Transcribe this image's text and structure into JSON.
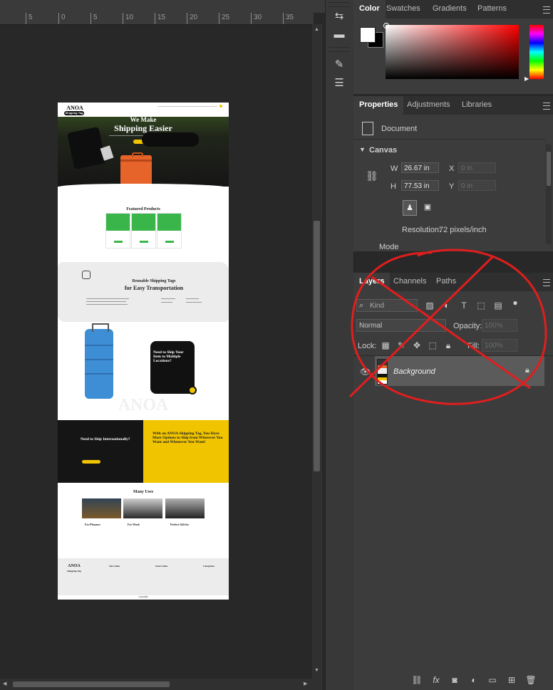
{
  "ruler": {
    "ticks": [
      "5",
      "0",
      "5",
      "10",
      "15",
      "20",
      "25",
      "30",
      "35"
    ]
  },
  "color_panel": {
    "tabs": [
      "Color",
      "Swatches",
      "Gradients",
      "Patterns"
    ],
    "active_tab": "Color",
    "foreground": "#ffffff",
    "background": "#000000",
    "hue": "#ff0000"
  },
  "properties_panel": {
    "tabs": [
      "Properties",
      "Adjustments",
      "Libraries"
    ],
    "active_tab": "Properties",
    "document_label": "Document",
    "section_title": "Canvas",
    "width_label": "W",
    "width_value": "26.67 in",
    "height_label": "H",
    "height_value": "77.53 in",
    "x_label": "X",
    "x_placeholder": "0 in",
    "y_label": "Y",
    "y_placeholder": "0 in",
    "resolution_label": "Resolution:",
    "resolution_value": "72 pixels/inch",
    "mode_label": "Mode"
  },
  "layers_panel": {
    "tabs": [
      "Layers",
      "Channels",
      "Paths"
    ],
    "active_tab": "Layers",
    "filter_placeholder": "Kind",
    "blend_mode": "Normal",
    "opacity_label": "Opacity:",
    "opacity_value": "100%",
    "lock_label": "Lock:",
    "fill_label": "Fill:",
    "fill_value": "100%",
    "layers": [
      {
        "name": "Background",
        "visible": true,
        "locked": true
      }
    ]
  },
  "page_mockup": {
    "logo": "ANOA",
    "logo_sub": "Shipping Tag",
    "hero_line1": "We Make",
    "hero_line2": "Shipping Easier",
    "featured_title": "Featured Products",
    "reusable_line1": "Reusable Shipping Tags",
    "reusable_line2": "for Easy Transportation",
    "need_title": "Need to Ship Your Item to Multiple Locations?",
    "intl_title": "Need to Ship Internationally?",
    "options_title": "With an ANOA Shipping Tag, You Have More Options to Ship from Wherever You Want and Whenever You Want!",
    "watermark": "ANOA",
    "many_uses": "Many Uses",
    "uses": [
      "For Pleasure",
      "For Work",
      "Perfect Gift for"
    ],
    "footer_logo": "ANOA",
    "footer_sub": "Shipping Tag",
    "footer_cols": [
      "Site Links",
      "Store Links",
      "Categories"
    ],
    "copyright": "Copyright"
  }
}
